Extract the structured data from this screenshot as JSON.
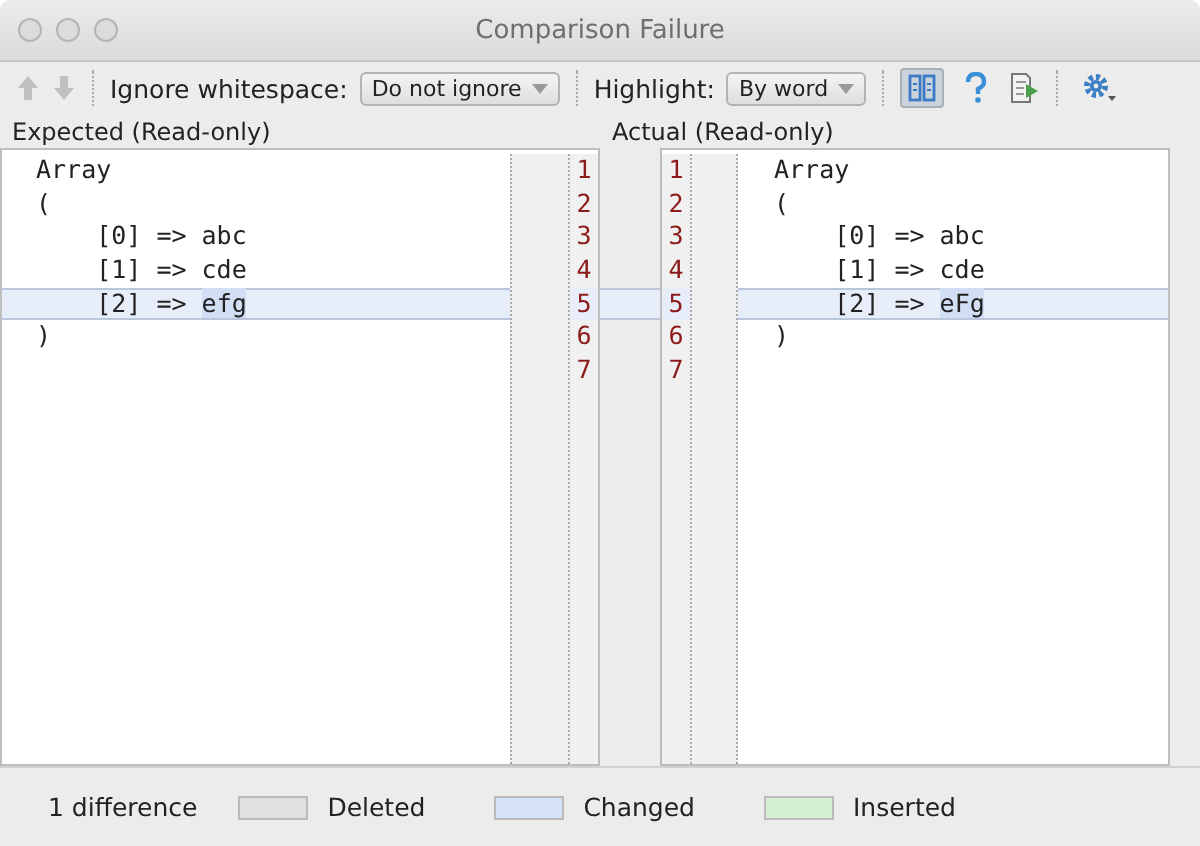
{
  "window": {
    "title": "Comparison Failure"
  },
  "toolbar": {
    "prev_disabled": true,
    "next_disabled": true,
    "whitespace_label": "Ignore whitespace:",
    "whitespace_value": "Do not ignore",
    "highlight_label": "Highlight:",
    "highlight_value": "By word",
    "side_by_side_selected": true
  },
  "left": {
    "header": "Expected (Read-only)",
    "lines": [
      {
        "number": "1",
        "text": "Array",
        "changed": false
      },
      {
        "number": "2",
        "text": "(",
        "changed": false
      },
      {
        "number": "3",
        "text": "    [0] => abc",
        "changed": false
      },
      {
        "number": "4",
        "text": "    [1] => cde",
        "changed": false
      },
      {
        "number": "5",
        "text": "    [2] => ",
        "changed_word": "efg",
        "changed": true
      },
      {
        "number": "6",
        "text": ")",
        "changed": false
      },
      {
        "number": "7",
        "changed": false
      }
    ]
  },
  "right": {
    "header": "Actual (Read-only)",
    "lines": [
      {
        "number": "1",
        "text": "Array",
        "changed": false
      },
      {
        "number": "2",
        "text": "(",
        "changed": false
      },
      {
        "number": "3",
        "text": "    [0] => abc",
        "changed": false
      },
      {
        "number": "4",
        "text": "    [1] => cde",
        "changed": false
      },
      {
        "number": "5",
        "text": "    [2] => ",
        "changed_word": "eFg",
        "changed": true
      },
      {
        "number": "6",
        "text": ")",
        "changed": false
      },
      {
        "number": "7",
        "changed": false
      }
    ]
  },
  "status_bar": {
    "summary": "1 difference",
    "legend": [
      {
        "label": "Deleted",
        "color": "#e0e0e0"
      },
      {
        "label": "Changed",
        "color": "#d6e2f7"
      },
      {
        "label": "Inserted",
        "color": "#d4f0d4"
      }
    ]
  }
}
